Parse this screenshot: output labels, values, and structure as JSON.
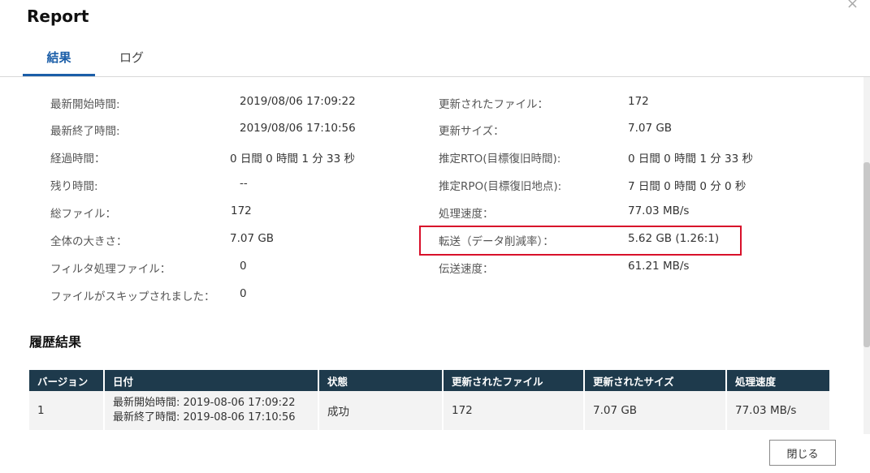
{
  "dialog": {
    "title": "Report",
    "close_icon": "×",
    "close_button_label": "閉じる"
  },
  "tabs": [
    {
      "label": "結果",
      "active": true
    },
    {
      "label": "ログ",
      "active": false
    }
  ],
  "info_left": [
    {
      "label": "最新開始時間:",
      "value": "2019/08/06 17:09:22"
    },
    {
      "label": "最新終了時間:",
      "value": "2019/08/06 17:10:56"
    },
    {
      "label": "経過時間：",
      "value": "0 日間 0 時間 1 分 33 秒"
    },
    {
      "label": "残り時間:",
      "value": "--"
    },
    {
      "label": "総ファイル：",
      "value": "172"
    },
    {
      "label": "全体の大きさ：",
      "value": "7.07 GB"
    },
    {
      "label": "フィルタ処理ファイル：",
      "value": "0"
    },
    {
      "label": "ファイルがスキップされました：",
      "value": "0"
    }
  ],
  "info_right": [
    {
      "label": "更新されたファイル：",
      "value": "172"
    },
    {
      "label": "更新サイズ：",
      "value": "7.07 GB"
    },
    {
      "label": "推定RTO(目標復旧時間):",
      "value": "0 日間 0 時間 1 分 33 秒"
    },
    {
      "label": "推定RPO(目標復旧地点):",
      "value": "7 日間 0 時間 0 分 0 秒"
    },
    {
      "label": "処理速度：",
      "value": "77.03 MB/s"
    },
    {
      "label": "転送（データ削減率）：",
      "value": "5.62 GB (1.26:1)"
    },
    {
      "label": "伝送速度：",
      "value": "61.21 MB/s"
    }
  ],
  "history": {
    "title": "履歴結果",
    "columns": [
      "バージョン",
      "日付",
      "状態",
      "更新されたファイル",
      "更新されたサイズ",
      "処理速度"
    ],
    "rows": [
      {
        "version": "1",
        "date_start": "最新開始時間: 2019-08-06 17:09:22",
        "date_end": "最新終了時間: 2019-08-06 17:10:56",
        "status": "成功",
        "updated_files": "172",
        "updated_size": "7.07 GB",
        "speed": "77.03 MB/s"
      }
    ]
  },
  "colors": {
    "accent": "#1b5ea8",
    "table_header": "#1e3a4c",
    "highlight_border": "#d8102a"
  }
}
